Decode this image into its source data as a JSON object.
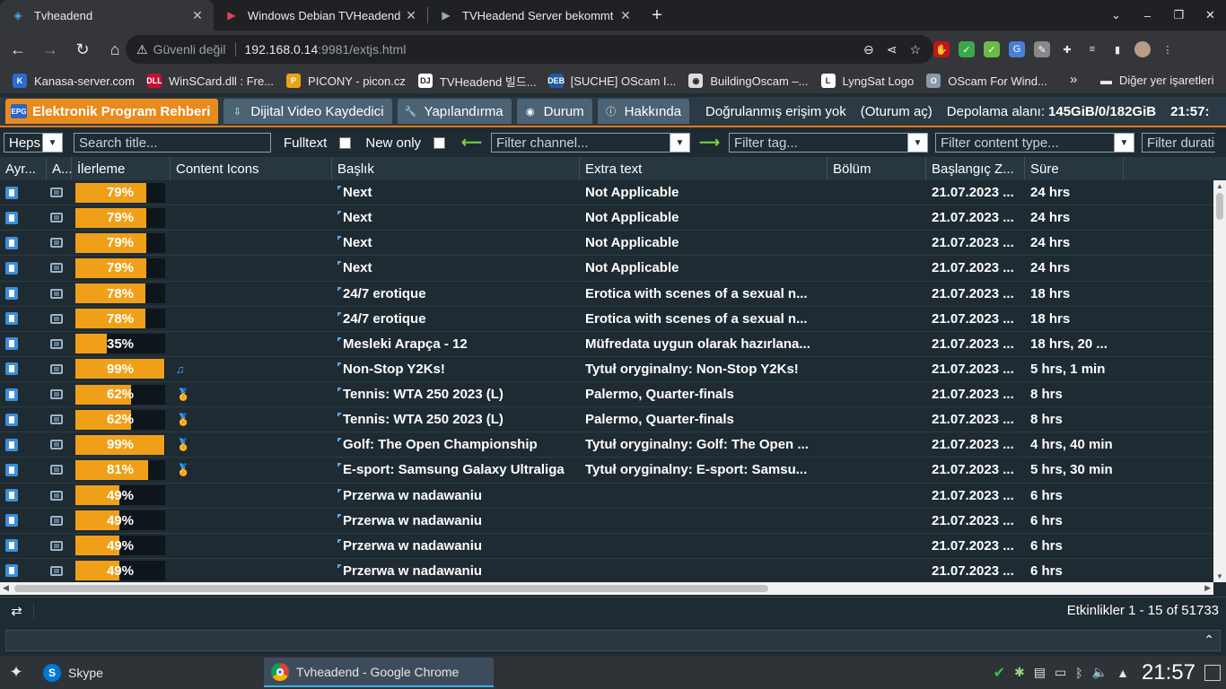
{
  "browser": {
    "tabs": [
      {
        "title": "Tvheadend",
        "active": true
      },
      {
        "title": "Windows Debian TVHeadend",
        "active": false
      },
      {
        "title": "TVHeadend Server bekommt",
        "active": false
      }
    ],
    "new_tab": "+",
    "window_controls": {
      "dropdown": "⌄",
      "minimize": "–",
      "maximize": "❐",
      "close": "✕"
    },
    "omnibox": {
      "security_label": "Güvenli değil",
      "host": "192.168.0.14",
      "path": ":9981/extjs.html"
    },
    "bookmarks": [
      {
        "label": "Kanasa-server.com",
        "icon_color": "#2a6bd1",
        "icon_text": "K"
      },
      {
        "label": "WinSCard.dll : Fre...",
        "icon_color": "#c8102e",
        "icon_text": "DLL"
      },
      {
        "label": "PICONY - picon.cz",
        "icon_color": "#e8a317",
        "icon_text": "P"
      },
      {
        "label": "TVHeadend 빌드...",
        "icon_color": "#ffffff",
        "icon_text": "DJ"
      },
      {
        "label": "[SUCHE] OScam I...",
        "icon_color": "#1e5aa8",
        "icon_text": "DEB"
      },
      {
        "label": "BuildingOscam –...",
        "icon_color": "#dddddd",
        "icon_text": "◉"
      },
      {
        "label": "LyngSat Logo",
        "icon_color": "#ffffff",
        "icon_text": "L"
      },
      {
        "label": "OScam For Wind...",
        "icon_color": "#8899aa",
        "icon_text": "O"
      }
    ],
    "bookmarks_more": "»",
    "other_bookmarks": "Diğer yer işaretleri"
  },
  "tvh": {
    "menu": [
      {
        "label": "Elektronik Program Rehberi",
        "icon": "EPG",
        "active": true
      },
      {
        "label": "Dijital Video Kaydedici",
        "icon": "⇩",
        "active": false
      },
      {
        "label": "Yapılandırma",
        "icon": "🔧",
        "active": false
      },
      {
        "label": "Durum",
        "icon": "◉",
        "active": false
      },
      {
        "label": "Hakkında",
        "icon": "ⓘ",
        "active": false
      }
    ],
    "status": {
      "access": "Doğrulanmış erişim yok",
      "login": "(Oturum aç)",
      "storage_label": "Depolama alanı:",
      "storage_value": "145GiB/0/182GiB",
      "time": "21:57:"
    },
    "filters": {
      "heps": "Heps",
      "search_placeholder": "Search title...",
      "fulltext_label": "Fulltext",
      "newonly_label": "New only",
      "channel_placeholder": "Filter channel...",
      "tag_placeholder": "Filter tag...",
      "content_type_placeholder": "Filter content type...",
      "duration_placeholder": "Filter duratio"
    },
    "columns": [
      "Ayr...",
      "A...",
      "İlerleme",
      "Content Icons",
      "Başlık",
      "Extra text",
      "Bölüm",
      "Başlangıç Z...",
      "Süre"
    ],
    "rows": [
      {
        "progress": 79,
        "progress_label": "79%",
        "icon": "",
        "title": "Next",
        "extra": "Not Applicable",
        "start": "21.07.2023 ...",
        "duration": "24 hrs"
      },
      {
        "progress": 79,
        "progress_label": "79%",
        "icon": "",
        "title": "Next",
        "extra": "Not Applicable",
        "start": "21.07.2023 ...",
        "duration": "24 hrs"
      },
      {
        "progress": 79,
        "progress_label": "79%",
        "icon": "",
        "title": "Next",
        "extra": "Not Applicable",
        "start": "21.07.2023 ...",
        "duration": "24 hrs"
      },
      {
        "progress": 79,
        "progress_label": "79%",
        "icon": "",
        "title": "Next",
        "extra": "Not Applicable",
        "start": "21.07.2023 ...",
        "duration": "24 hrs"
      },
      {
        "progress": 78,
        "progress_label": "78%",
        "icon": "",
        "title": "24/7 erotique",
        "extra": "Erotica with scenes of a sexual n...",
        "start": "21.07.2023 ...",
        "duration": "18 hrs"
      },
      {
        "progress": 78,
        "progress_label": "78%",
        "icon": "",
        "title": "24/7 erotique",
        "extra": "Erotica with scenes of a sexual n...",
        "start": "21.07.2023 ...",
        "duration": "18 hrs"
      },
      {
        "progress": 35,
        "progress_label": "35%",
        "icon": "",
        "title": "Mesleki Arapça - 12",
        "extra": "Müfredata uygun olarak hazırlana...",
        "start": "21.07.2023 ...",
        "duration": "18 hrs, 20 ..."
      },
      {
        "progress": 99,
        "progress_label": "99%",
        "icon": "music",
        "title": "Non-Stop Y2Ks!",
        "extra": "Tytuł oryginalny: Non-Stop Y2Ks!",
        "start": "21.07.2023 ...",
        "duration": "5 hrs, 1 min"
      },
      {
        "progress": 62,
        "progress_label": "62%",
        "icon": "medal",
        "title": "Tennis: WTA 250 2023 (L)",
        "extra": "Palermo, Quarter-finals",
        "start": "21.07.2023 ...",
        "duration": "8 hrs"
      },
      {
        "progress": 62,
        "progress_label": "62%",
        "icon": "medal",
        "title": "Tennis: WTA 250 2023 (L)",
        "extra": "Palermo, Quarter-finals",
        "start": "21.07.2023 ...",
        "duration": "8 hrs"
      },
      {
        "progress": 99,
        "progress_label": "99%",
        "icon": "medal",
        "title": "Golf: The Open Championship",
        "extra": "Tytuł oryginalny: Golf: The Open ...",
        "start": "21.07.2023 ...",
        "duration": "4 hrs, 40 min"
      },
      {
        "progress": 81,
        "progress_label": "81%",
        "icon": "medal",
        "title": "E-sport: Samsung Galaxy Ultraliga",
        "extra": "Tytuł oryginalny: E-sport: Samsu...",
        "start": "21.07.2023 ...",
        "duration": "5 hrs, 30 min"
      },
      {
        "progress": 49,
        "progress_label": "49%",
        "icon": "",
        "title": "Przerwa w nadawaniu",
        "extra": "",
        "start": "21.07.2023 ...",
        "duration": "6 hrs"
      },
      {
        "progress": 49,
        "progress_label": "49%",
        "icon": "",
        "title": "Przerwa w nadawaniu",
        "extra": "",
        "start": "21.07.2023 ...",
        "duration": "6 hrs"
      },
      {
        "progress": 49,
        "progress_label": "49%",
        "icon": "",
        "title": "Przerwa w nadawaniu",
        "extra": "",
        "start": "21.07.2023 ...",
        "duration": "6 hrs"
      },
      {
        "progress": 49,
        "progress_label": "49%",
        "icon": "",
        "title": "Przerwa w nadawaniu",
        "extra": "",
        "start": "21.07.2023 ...",
        "duration": "6 hrs"
      }
    ],
    "paging": "Etkinlikler 1 - 15 of 51733"
  },
  "taskbar": {
    "items": [
      {
        "label": "Skype",
        "icon_color": "#0078d4",
        "icon_text": "S",
        "active": false
      },
      {
        "label": "Tvheadend - Google Chrome",
        "icon_color": "#db4437",
        "icon_text": "◎",
        "active": true
      }
    ],
    "clock": "21:57"
  },
  "colors": {
    "accent": "#e88b1e",
    "progress": "#f0a018",
    "background": "#1f2b33"
  }
}
